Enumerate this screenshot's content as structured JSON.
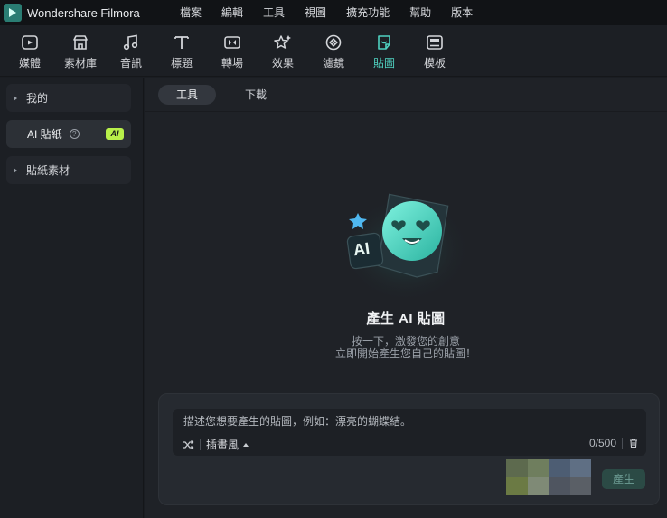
{
  "app": {
    "title": "Wondershare Filmora"
  },
  "menu": [
    "檔案",
    "編輯",
    "工具",
    "視圖",
    "擴充功能",
    "幫助",
    "版本"
  ],
  "toolbar": [
    {
      "label": "媒體",
      "icon": "media-icon"
    },
    {
      "label": "素材庫",
      "icon": "stock-library-icon"
    },
    {
      "label": "音訊",
      "icon": "audio-icon"
    },
    {
      "label": "標題",
      "icon": "title-icon"
    },
    {
      "label": "轉場",
      "icon": "transition-icon"
    },
    {
      "label": "效果",
      "icon": "effects-icon"
    },
    {
      "label": "濾鏡",
      "icon": "filters-icon"
    },
    {
      "label": "貼圖",
      "icon": "stickers-icon",
      "active": true
    },
    {
      "label": "模板",
      "icon": "templates-icon"
    }
  ],
  "sidebar": {
    "items": [
      {
        "label": "我的"
      },
      {
        "label": "AI 貼紙",
        "badge": "AI",
        "active": true
      },
      {
        "label": "貼紙素材"
      }
    ]
  },
  "tabs": [
    {
      "label": "工具",
      "active": true
    },
    {
      "label": "下載"
    }
  ],
  "hero": {
    "art_badge": "AI",
    "title": "產生 AI 貼圖",
    "desc_line1": "按一下，激發您的創意",
    "desc_line2": "立即開始產生您自己的貼圖！"
  },
  "prompt": {
    "placeholder": "描述您想要產生的貼圖，例如：漂亮的蝴蝶結。",
    "style_label": "插畫風",
    "counter": "0/500",
    "generate_label": "產生"
  },
  "colors": {
    "accent": "#4fd1c0",
    "ai_badge": "#b8f04a",
    "thumbs": [
      "#5d6a4e",
      "#6f7e5e",
      "#4d5d73",
      "#5f6f84",
      "#6b7a44",
      "#7f8a76",
      "#4f5560",
      "#5a5f66"
    ]
  }
}
